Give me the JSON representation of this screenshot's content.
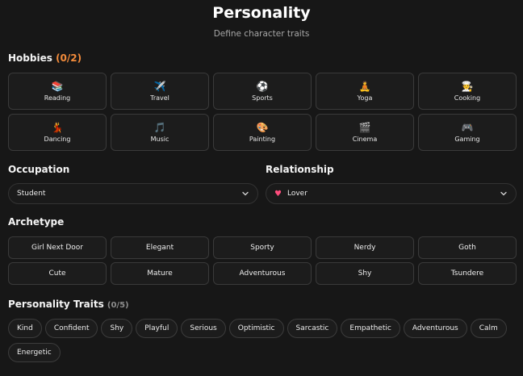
{
  "header": {
    "title": "Personality",
    "subtitle": "Define character traits"
  },
  "hobbies": {
    "label": "Hobbies",
    "count": "(0/2)",
    "items": [
      {
        "label": "Reading",
        "icon": "books-icon",
        "glyph": "📚"
      },
      {
        "label": "Travel",
        "icon": "airplane-icon",
        "glyph": "✈️"
      },
      {
        "label": "Sports",
        "icon": "soccer-ball-icon",
        "glyph": "⚽"
      },
      {
        "label": "Yoga",
        "icon": "yoga-icon",
        "glyph": "🧘"
      },
      {
        "label": "Cooking",
        "icon": "chef-icon",
        "glyph": "🧑‍🍳"
      },
      {
        "label": "Dancing",
        "icon": "dancer-icon",
        "glyph": "💃"
      },
      {
        "label": "Music",
        "icon": "music-note-icon",
        "glyph": "🎵"
      },
      {
        "label": "Painting",
        "icon": "palette-icon",
        "glyph": "🎨"
      },
      {
        "label": "Cinema",
        "icon": "clapperboard-icon",
        "glyph": "🎬"
      },
      {
        "label": "Gaming",
        "icon": "gamepad-icon",
        "glyph": "🎮"
      }
    ]
  },
  "occupation": {
    "label": "Occupation",
    "value": "Student"
  },
  "relationship": {
    "label": "Relationship",
    "value": "Lover",
    "icon": "heart-icon",
    "glyph": "♥"
  },
  "archetype": {
    "label": "Archetype",
    "items": [
      "Girl Next Door",
      "Elegant",
      "Sporty",
      "Nerdy",
      "Goth",
      "Cute",
      "Mature",
      "Adventurous",
      "Shy",
      "Tsundere"
    ]
  },
  "traits": {
    "label": "Personality Traits",
    "count": "(0/5)",
    "items": [
      "Kind",
      "Confident",
      "Shy",
      "Playful",
      "Serious",
      "Optimistic",
      "Sarcastic",
      "Empathetic",
      "Adventurous",
      "Calm",
      "Energetic"
    ]
  }
}
